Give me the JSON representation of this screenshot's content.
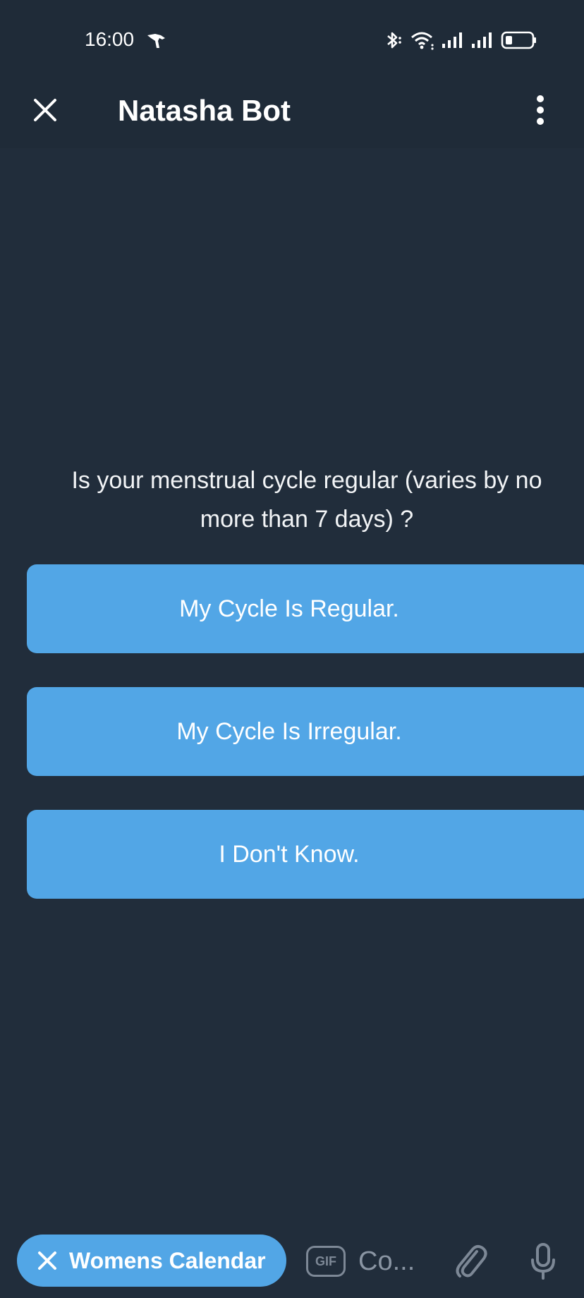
{
  "status_bar": {
    "time": "16:00",
    "icons": [
      "activity-icon",
      "bluetooth-icon",
      "wifi-icon",
      "signal-icon",
      "signal-icon",
      "battery-icon"
    ]
  },
  "header": {
    "title": "Natasha Bot",
    "close_icon": "close-icon",
    "menu_icon": "more-vertical-icon"
  },
  "chat": {
    "message": "Is your menstrual cycle regular (varies by no more than 7 days) ?",
    "replies": [
      {
        "label": "My Cycle Is Regular."
      },
      {
        "label": "My Cycle Is Irregular."
      },
      {
        "label": "I Don't Know."
      }
    ]
  },
  "composer": {
    "chip_label": "Womens Calendar",
    "gif_label": "GIF",
    "input_text": "Co..."
  },
  "colors": {
    "background": "#212d3b",
    "button": "#52a6e6",
    "text": "#ffffff",
    "muted": "#7d8896"
  }
}
